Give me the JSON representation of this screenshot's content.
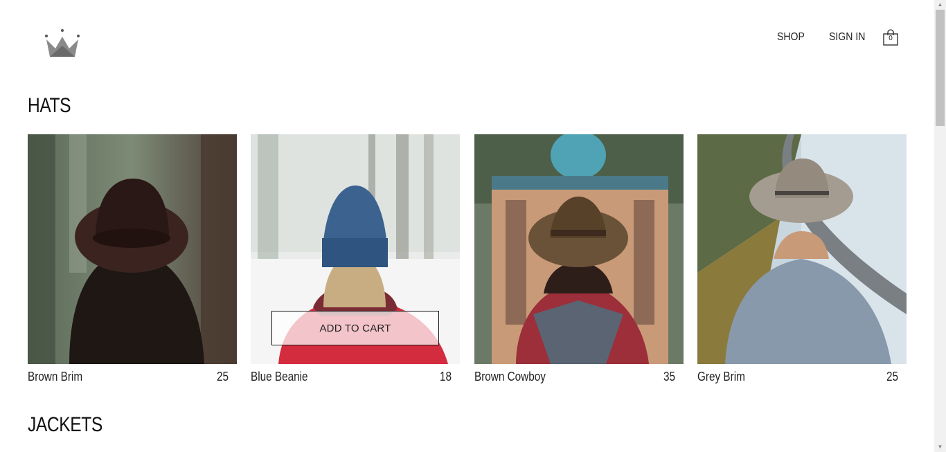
{
  "header": {
    "logo_icon": "crown-icon",
    "nav": {
      "shop_label": "SHOP",
      "signin_label": "SIGN IN",
      "cart_icon": "shopping-bag-icon",
      "cart_count": "0"
    }
  },
  "sections": {
    "hats_title": "HATS",
    "jackets_title": "JACKETS"
  },
  "products": [
    {
      "name": "Brown Brim",
      "price": "25"
    },
    {
      "name": "Blue Beanie",
      "price": "18"
    },
    {
      "name": "Brown Cowboy",
      "price": "35"
    },
    {
      "name": "Grey Brim",
      "price": "25"
    }
  ],
  "add_to_cart_label": "ADD TO CART",
  "colors": {
    "text": "#222222",
    "button_border": "#111111"
  }
}
